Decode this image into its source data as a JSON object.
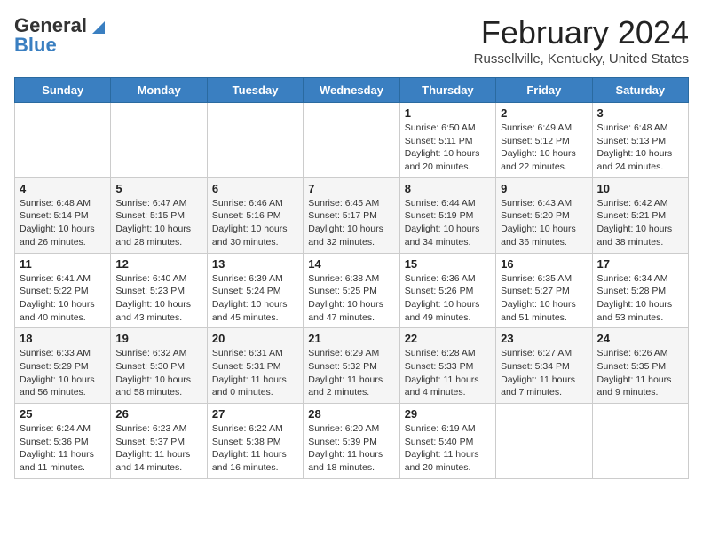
{
  "header": {
    "logo_general": "General",
    "logo_blue": "Blue",
    "month_title": "February 2024",
    "location": "Russellville, Kentucky, United States"
  },
  "days_of_week": [
    "Sunday",
    "Monday",
    "Tuesday",
    "Wednesday",
    "Thursday",
    "Friday",
    "Saturday"
  ],
  "weeks": [
    [
      {
        "day": "",
        "info": ""
      },
      {
        "day": "",
        "info": ""
      },
      {
        "day": "",
        "info": ""
      },
      {
        "day": "",
        "info": ""
      },
      {
        "day": "1",
        "info": "Sunrise: 6:50 AM\nSunset: 5:11 PM\nDaylight: 10 hours and 20 minutes."
      },
      {
        "day": "2",
        "info": "Sunrise: 6:49 AM\nSunset: 5:12 PM\nDaylight: 10 hours and 22 minutes."
      },
      {
        "day": "3",
        "info": "Sunrise: 6:48 AM\nSunset: 5:13 PM\nDaylight: 10 hours and 24 minutes."
      }
    ],
    [
      {
        "day": "4",
        "info": "Sunrise: 6:48 AM\nSunset: 5:14 PM\nDaylight: 10 hours and 26 minutes."
      },
      {
        "day": "5",
        "info": "Sunrise: 6:47 AM\nSunset: 5:15 PM\nDaylight: 10 hours and 28 minutes."
      },
      {
        "day": "6",
        "info": "Sunrise: 6:46 AM\nSunset: 5:16 PM\nDaylight: 10 hours and 30 minutes."
      },
      {
        "day": "7",
        "info": "Sunrise: 6:45 AM\nSunset: 5:17 PM\nDaylight: 10 hours and 32 minutes."
      },
      {
        "day": "8",
        "info": "Sunrise: 6:44 AM\nSunset: 5:19 PM\nDaylight: 10 hours and 34 minutes."
      },
      {
        "day": "9",
        "info": "Sunrise: 6:43 AM\nSunset: 5:20 PM\nDaylight: 10 hours and 36 minutes."
      },
      {
        "day": "10",
        "info": "Sunrise: 6:42 AM\nSunset: 5:21 PM\nDaylight: 10 hours and 38 minutes."
      }
    ],
    [
      {
        "day": "11",
        "info": "Sunrise: 6:41 AM\nSunset: 5:22 PM\nDaylight: 10 hours and 40 minutes."
      },
      {
        "day": "12",
        "info": "Sunrise: 6:40 AM\nSunset: 5:23 PM\nDaylight: 10 hours and 43 minutes."
      },
      {
        "day": "13",
        "info": "Sunrise: 6:39 AM\nSunset: 5:24 PM\nDaylight: 10 hours and 45 minutes."
      },
      {
        "day": "14",
        "info": "Sunrise: 6:38 AM\nSunset: 5:25 PM\nDaylight: 10 hours and 47 minutes."
      },
      {
        "day": "15",
        "info": "Sunrise: 6:36 AM\nSunset: 5:26 PM\nDaylight: 10 hours and 49 minutes."
      },
      {
        "day": "16",
        "info": "Sunrise: 6:35 AM\nSunset: 5:27 PM\nDaylight: 10 hours and 51 minutes."
      },
      {
        "day": "17",
        "info": "Sunrise: 6:34 AM\nSunset: 5:28 PM\nDaylight: 10 hours and 53 minutes."
      }
    ],
    [
      {
        "day": "18",
        "info": "Sunrise: 6:33 AM\nSunset: 5:29 PM\nDaylight: 10 hours and 56 minutes."
      },
      {
        "day": "19",
        "info": "Sunrise: 6:32 AM\nSunset: 5:30 PM\nDaylight: 10 hours and 58 minutes."
      },
      {
        "day": "20",
        "info": "Sunrise: 6:31 AM\nSunset: 5:31 PM\nDaylight: 11 hours and 0 minutes."
      },
      {
        "day": "21",
        "info": "Sunrise: 6:29 AM\nSunset: 5:32 PM\nDaylight: 11 hours and 2 minutes."
      },
      {
        "day": "22",
        "info": "Sunrise: 6:28 AM\nSunset: 5:33 PM\nDaylight: 11 hours and 4 minutes."
      },
      {
        "day": "23",
        "info": "Sunrise: 6:27 AM\nSunset: 5:34 PM\nDaylight: 11 hours and 7 minutes."
      },
      {
        "day": "24",
        "info": "Sunrise: 6:26 AM\nSunset: 5:35 PM\nDaylight: 11 hours and 9 minutes."
      }
    ],
    [
      {
        "day": "25",
        "info": "Sunrise: 6:24 AM\nSunset: 5:36 PM\nDaylight: 11 hours and 11 minutes."
      },
      {
        "day": "26",
        "info": "Sunrise: 6:23 AM\nSunset: 5:37 PM\nDaylight: 11 hours and 14 minutes."
      },
      {
        "day": "27",
        "info": "Sunrise: 6:22 AM\nSunset: 5:38 PM\nDaylight: 11 hours and 16 minutes."
      },
      {
        "day": "28",
        "info": "Sunrise: 6:20 AM\nSunset: 5:39 PM\nDaylight: 11 hours and 18 minutes."
      },
      {
        "day": "29",
        "info": "Sunrise: 6:19 AM\nSunset: 5:40 PM\nDaylight: 11 hours and 20 minutes."
      },
      {
        "day": "",
        "info": ""
      },
      {
        "day": "",
        "info": ""
      }
    ]
  ]
}
